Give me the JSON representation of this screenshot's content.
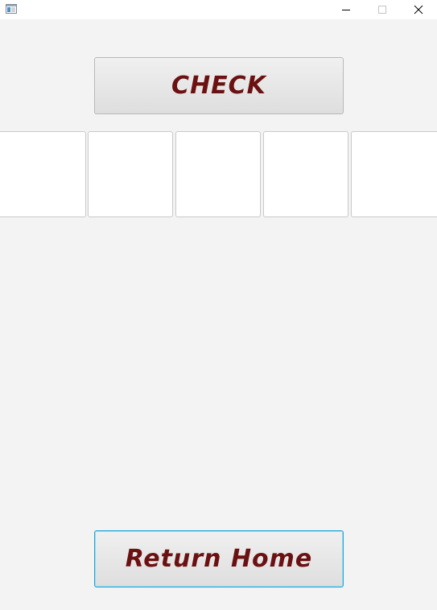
{
  "window": {
    "minimize_glyph": "─",
    "maximize_glyph": "☐",
    "close_glyph": "✕",
    "icons": {
      "app": "app-window-icon",
      "minimize": "minimize-icon",
      "maximize": "maximize-icon",
      "close": "close-icon"
    }
  },
  "buttons": {
    "check_label": "CHECK",
    "return_home_label": "Return Home"
  },
  "inputs": [
    {
      "value": ""
    },
    {
      "value": ""
    },
    {
      "value": ""
    },
    {
      "value": ""
    },
    {
      "value": ""
    }
  ],
  "colors": {
    "background": "#f3f3f3",
    "button_text": "#6b1111",
    "focus_border": "#1ba7d4"
  }
}
